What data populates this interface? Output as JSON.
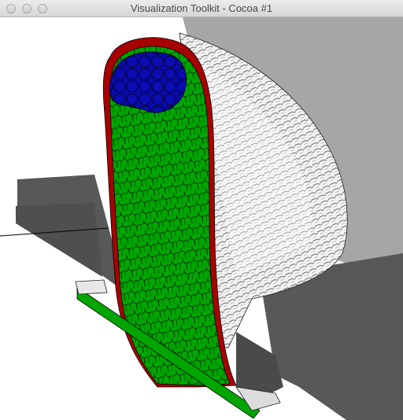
{
  "window": {
    "title": "Visualization Toolkit - Cocoa #1",
    "controls": {
      "close": "close-button",
      "minimize": "minimize-button",
      "zoom": "zoom-button"
    }
  },
  "scene": {
    "description_colors": {
      "background": "#ffffff",
      "wall": "#a6a6a6",
      "floor_shadow": "#585858",
      "ground_shadow": "#4a4a4a",
      "green_region": "#00a500",
      "blue_region": "#0a0aa8",
      "red_rim": "#a80000",
      "white_surface": "#f0f0f0",
      "outline": "#000000"
    }
  }
}
